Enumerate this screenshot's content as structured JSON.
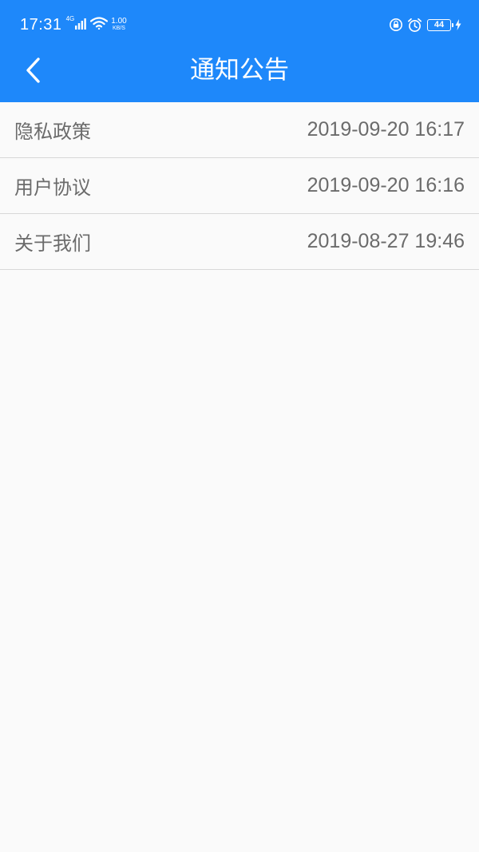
{
  "status_bar": {
    "time": "17:31",
    "network_type": "4G",
    "speed_value": "1.00",
    "speed_unit": "KB/S",
    "battery_level": "44",
    "icons": [
      "signal-icon",
      "wifi-icon",
      "rotation-lock-icon",
      "alarm-icon",
      "battery-icon",
      "charging-bolt-icon"
    ]
  },
  "app_bar": {
    "title": "通知公告",
    "back_icon": "chevron-left-icon",
    "color": "#1e88fa"
  },
  "notices": [
    {
      "title": "隐私政策",
      "date": "2019-09-20 16:17"
    },
    {
      "title": "用户协议",
      "date": "2019-09-20 16:16"
    },
    {
      "title": "关于我们",
      "date": "2019-08-27 19:46"
    }
  ]
}
